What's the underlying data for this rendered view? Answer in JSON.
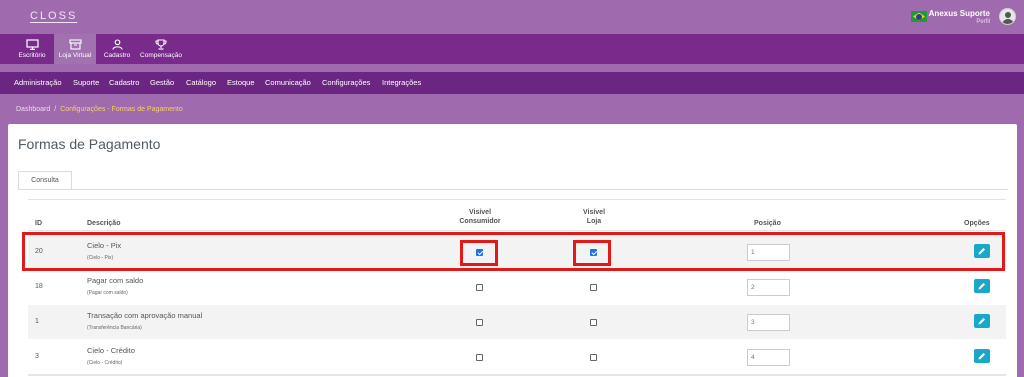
{
  "topbar": {
    "logo": "CLOSS",
    "user_name": "Anexus Suporte",
    "user_role": "Perfil"
  },
  "modules": [
    {
      "label": "Escritório",
      "icon": "monitor-icon",
      "active": false
    },
    {
      "label": "Loja Virtual",
      "icon": "store-icon",
      "active": true
    },
    {
      "label": "Cadastro",
      "icon": "user-icon",
      "active": false
    },
    {
      "label": "Compensação",
      "icon": "trophy-icon",
      "active": false
    }
  ],
  "nav": [
    "Administração",
    "Suporte",
    "Cadastro",
    "Gestão",
    "Catálogo",
    "Estoque",
    "Comunicação",
    "Configurações",
    "Integrações"
  ],
  "breadcrumb": {
    "home": "Dashboard",
    "separator": "/",
    "current": "Configurações - Formas de Pagamento"
  },
  "page": {
    "title": "Formas de Pagamento",
    "tab": "Consulta"
  },
  "table": {
    "headers": {
      "id": "ID",
      "descricao": "Descrição",
      "visivel_consumidor_1": "Visível",
      "visivel_consumidor_2": "Consumidor",
      "visivel_loja_1": "Visível",
      "visivel_loja_2": "Loja",
      "posicao": "Posição",
      "opcoes": "Opções"
    },
    "rows": [
      {
        "id": "20",
        "name": "Cielo - Pix",
        "sub": "(Cielo - Pix)",
        "consumidor": true,
        "loja": true,
        "posicao": "1"
      },
      {
        "id": "18",
        "name": "Pagar com saldo",
        "sub": "(Pagar com saldo)",
        "consumidor": false,
        "loja": false,
        "posicao": "2"
      },
      {
        "id": "1",
        "name": "Transação com aprovação manual",
        "sub": "(Transferência Bancária)",
        "consumidor": false,
        "loja": false,
        "posicao": "3"
      },
      {
        "id": "3",
        "name": "Cielo - Crédito",
        "sub": "(Cielo - Crédito)",
        "consumidor": false,
        "loja": false,
        "posicao": "4"
      }
    ]
  },
  "colors": {
    "header_purple": "#a06aae",
    "module_bar": "#792b8c",
    "nav_bar": "#6b2681",
    "breadcrumb_current": "#f4d466",
    "highlight_red": "#e01919",
    "edit_button": "#1ba7c9",
    "checkbox_checked": "#1a73e8"
  }
}
